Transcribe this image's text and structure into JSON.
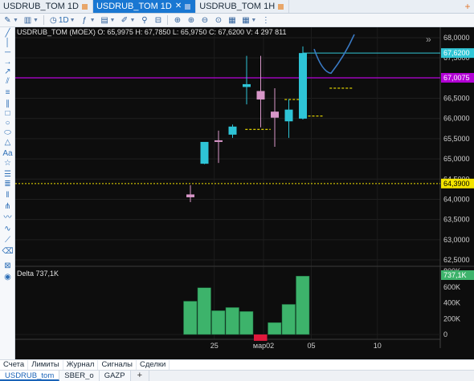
{
  "tabs": [
    {
      "label": "USDRUB_TOM 1D",
      "active": false
    },
    {
      "label": "USDRUB_TOM 1D",
      "active": true
    },
    {
      "label": "USDRUB_TOM 1H",
      "active": false
    }
  ],
  "toolbar": {
    "timeframe": "1D"
  },
  "chart": {
    "header": "USDRUB_TOM (MOEX) O: 65,9975 H: 67,7850 L: 65,9750 C: 67,6200 V: 4 297 811",
    "price_axis_labels": [
      "68,0000",
      "67,5000",
      "67,0000",
      "66,5000",
      "66,0000",
      "65,5000",
      "65,0000",
      "64,5000",
      "64,0000",
      "63,5000",
      "63,0000",
      "62,5000"
    ],
    "current_price_tag": "67,6200",
    "purple_line_tag": "67,0075",
    "yellow_line_tag": "64,3900",
    "volume_axis_labels": [
      "800K",
      "600K",
      "400K",
      "200K",
      "0"
    ],
    "delta_header": "Delta 737,1K",
    "delta_tag": "737,1K",
    "date_labels": [
      "25",
      "мар02",
      "05",
      "10"
    ],
    "colors": {
      "background": "#0d0d0d",
      "bull": "#2ec4d6",
      "bear": "#d796c8",
      "delta_pos": "#3db36b",
      "delta_neg": "#e0193c",
      "purple_line": "#b300d6",
      "yellow_line": "#f3e400",
      "current_tag": "#31c6d6",
      "trend": "#3a7ac4"
    }
  },
  "chart_data": {
    "type": "candlestick",
    "title": "USDRUB_TOM (MOEX)",
    "ylim": [
      62.5,
      68.0
    ],
    "candles": [
      {
        "o": 64.12,
        "h": 64.35,
        "l": 63.93,
        "c": 64.05,
        "bull": false
      },
      {
        "o": 64.88,
        "h": 65.35,
        "l": 64.87,
        "c": 65.42,
        "bull": true
      },
      {
        "o": 65.46,
        "h": 65.7,
        "l": 64.9,
        "c": 65.44,
        "bull": false
      },
      {
        "o": 65.6,
        "h": 65.85,
        "l": 65.52,
        "c": 65.8,
        "bull": true
      },
      {
        "o": 66.78,
        "h": 67.55,
        "l": 66.35,
        "c": 66.85,
        "bull": true
      },
      {
        "o": 66.68,
        "h": 67.55,
        "l": 65.78,
        "c": 66.47,
        "bull": false
      },
      {
        "o": 66.17,
        "h": 66.75,
        "l": 65.3,
        "c": 66.02,
        "bull": false
      },
      {
        "o": 65.93,
        "h": 66.48,
        "l": 65.52,
        "c": 66.22,
        "bull": true
      },
      {
        "o": 65.9975,
        "h": 67.785,
        "l": 65.975,
        "c": 67.62,
        "bull": true
      }
    ],
    "delta": [
      420,
      590,
      300,
      340,
      290,
      -80,
      150,
      380,
      737.1
    ],
    "delta_unit": "K",
    "levels": {
      "current": 67.62,
      "purple": 67.0075,
      "yellow": 64.39
    },
    "dashed_levels": [
      {
        "value": 65.73
      },
      {
        "value": 66.47
      },
      {
        "value": 66.06
      },
      {
        "value": 66.75
      }
    ]
  }
}
